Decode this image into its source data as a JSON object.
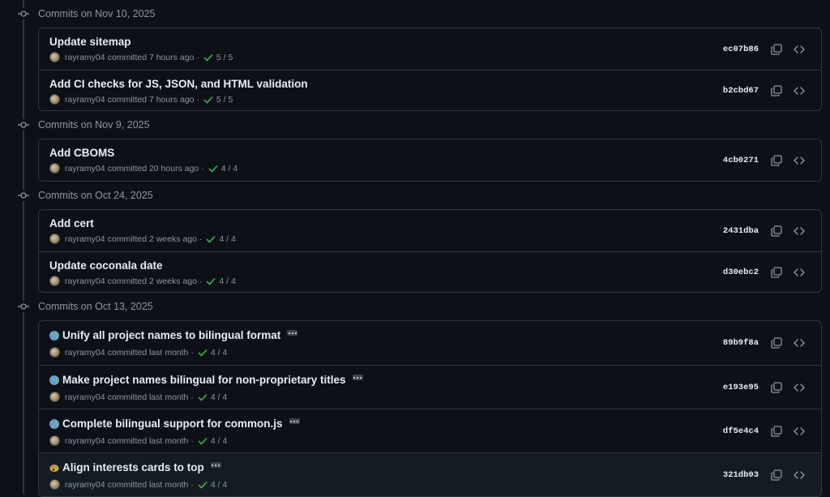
{
  "colors": {
    "background": "#0d1117",
    "border": "#30363d",
    "muted_text": "#8d96a0",
    "primary_text": "#e6edf3",
    "check_green": "#3fb950",
    "hover_row": "#151b23"
  },
  "groups": [
    {
      "title": "Commits on Nov 10, 2025",
      "commits": [
        {
          "title": "Update sitemap",
          "emoji": "",
          "author": "rayramy04",
          "time": "committed 7 hours ago",
          "checks": "5 / 5",
          "sha": "ec07b86",
          "has_ellipsis": false
        },
        {
          "title": "Add CI checks for JS, JSON, and HTML validation",
          "emoji": "",
          "author": "rayramy04",
          "time": "committed 7 hours ago",
          "checks": "5 / 5",
          "sha": "b2cbd67",
          "has_ellipsis": false
        }
      ]
    },
    {
      "title": "Commits on Nov 9, 2025",
      "commits": [
        {
          "title": "Add CBOMS",
          "emoji": "",
          "author": "rayramy04",
          "time": "committed 20 hours ago",
          "checks": "4 / 4",
          "sha": "4cb0271",
          "has_ellipsis": false
        }
      ]
    },
    {
      "title": "Commits on Oct 24, 2025",
      "commits": [
        {
          "title": "Add cert",
          "emoji": "",
          "author": "rayramy04",
          "time": "committed 2 weeks ago",
          "checks": "4 / 4",
          "sha": "2431dba",
          "has_ellipsis": false
        },
        {
          "title": "Update coconala date",
          "emoji": "",
          "author": "rayramy04",
          "time": "committed 2 weeks ago",
          "checks": "4 / 4",
          "sha": "d30ebc2",
          "has_ellipsis": false
        }
      ]
    },
    {
      "title": "Commits on Oct 13, 2025",
      "commits": [
        {
          "title": "Unify all project names to bilingual format",
          "emoji": "globe-icon",
          "author": "rayramy04",
          "time": "committed last month",
          "checks": "4 / 4",
          "sha": "89b9f8a",
          "has_ellipsis": true
        },
        {
          "title": "Make project names bilingual for non-proprietary titles",
          "emoji": "globe-icon",
          "author": "rayramy04",
          "time": "committed last month",
          "checks": "4 / 4",
          "sha": "e193e95",
          "has_ellipsis": true
        },
        {
          "title": "Complete bilingual support for common.js",
          "emoji": "globe-icon",
          "author": "rayramy04",
          "time": "committed last month",
          "checks": "4 / 4",
          "sha": "df5e4c4",
          "has_ellipsis": true
        },
        {
          "title": "Align interests cards to top",
          "emoji": "art-palette-icon",
          "author": "rayramy04",
          "time": "committed last month",
          "checks": "4 / 4",
          "sha": "321db03",
          "has_ellipsis": true
        }
      ]
    }
  ]
}
